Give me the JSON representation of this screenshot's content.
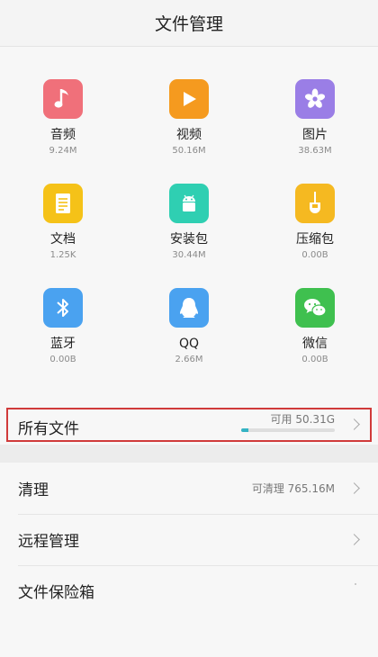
{
  "header": {
    "title": "文件管理"
  },
  "categories": [
    {
      "label": "音频",
      "size": "9.24M",
      "color": "#f0707a",
      "icon": "music-note-icon"
    },
    {
      "label": "视频",
      "size": "50.16M",
      "color": "#f59a1f",
      "icon": "play-icon"
    },
    {
      "label": "图片",
      "size": "38.63M",
      "color": "#9a7ee6",
      "icon": "flower-icon"
    },
    {
      "label": "文档",
      "size": "1.25K",
      "color": "#f5c218",
      "icon": "document-icon"
    },
    {
      "label": "安装包",
      "size": "30.44M",
      "color": "#2fcfb2",
      "icon": "android-icon"
    },
    {
      "label": "压缩包",
      "size": "0.00B",
      "color": "#f5b921",
      "icon": "zip-icon"
    },
    {
      "label": "蓝牙",
      "size": "0.00B",
      "color": "#4aa2f0",
      "icon": "bluetooth-icon"
    },
    {
      "label": "QQ",
      "size": "2.66M",
      "color": "#4aa2f0",
      "icon": "qq-penguin-icon"
    },
    {
      "label": "微信",
      "size": "0.00B",
      "color": "#3fc04f",
      "icon": "wechat-icon"
    }
  ],
  "all_files": {
    "label": "所有文件",
    "available": "可用 50.31G",
    "usage_fraction": 0.08
  },
  "list": [
    {
      "label": "清理",
      "value": "可清理 765.16M"
    },
    {
      "label": "远程管理",
      "value": ""
    },
    {
      "label": "文件保险箱",
      "value": ""
    }
  ]
}
